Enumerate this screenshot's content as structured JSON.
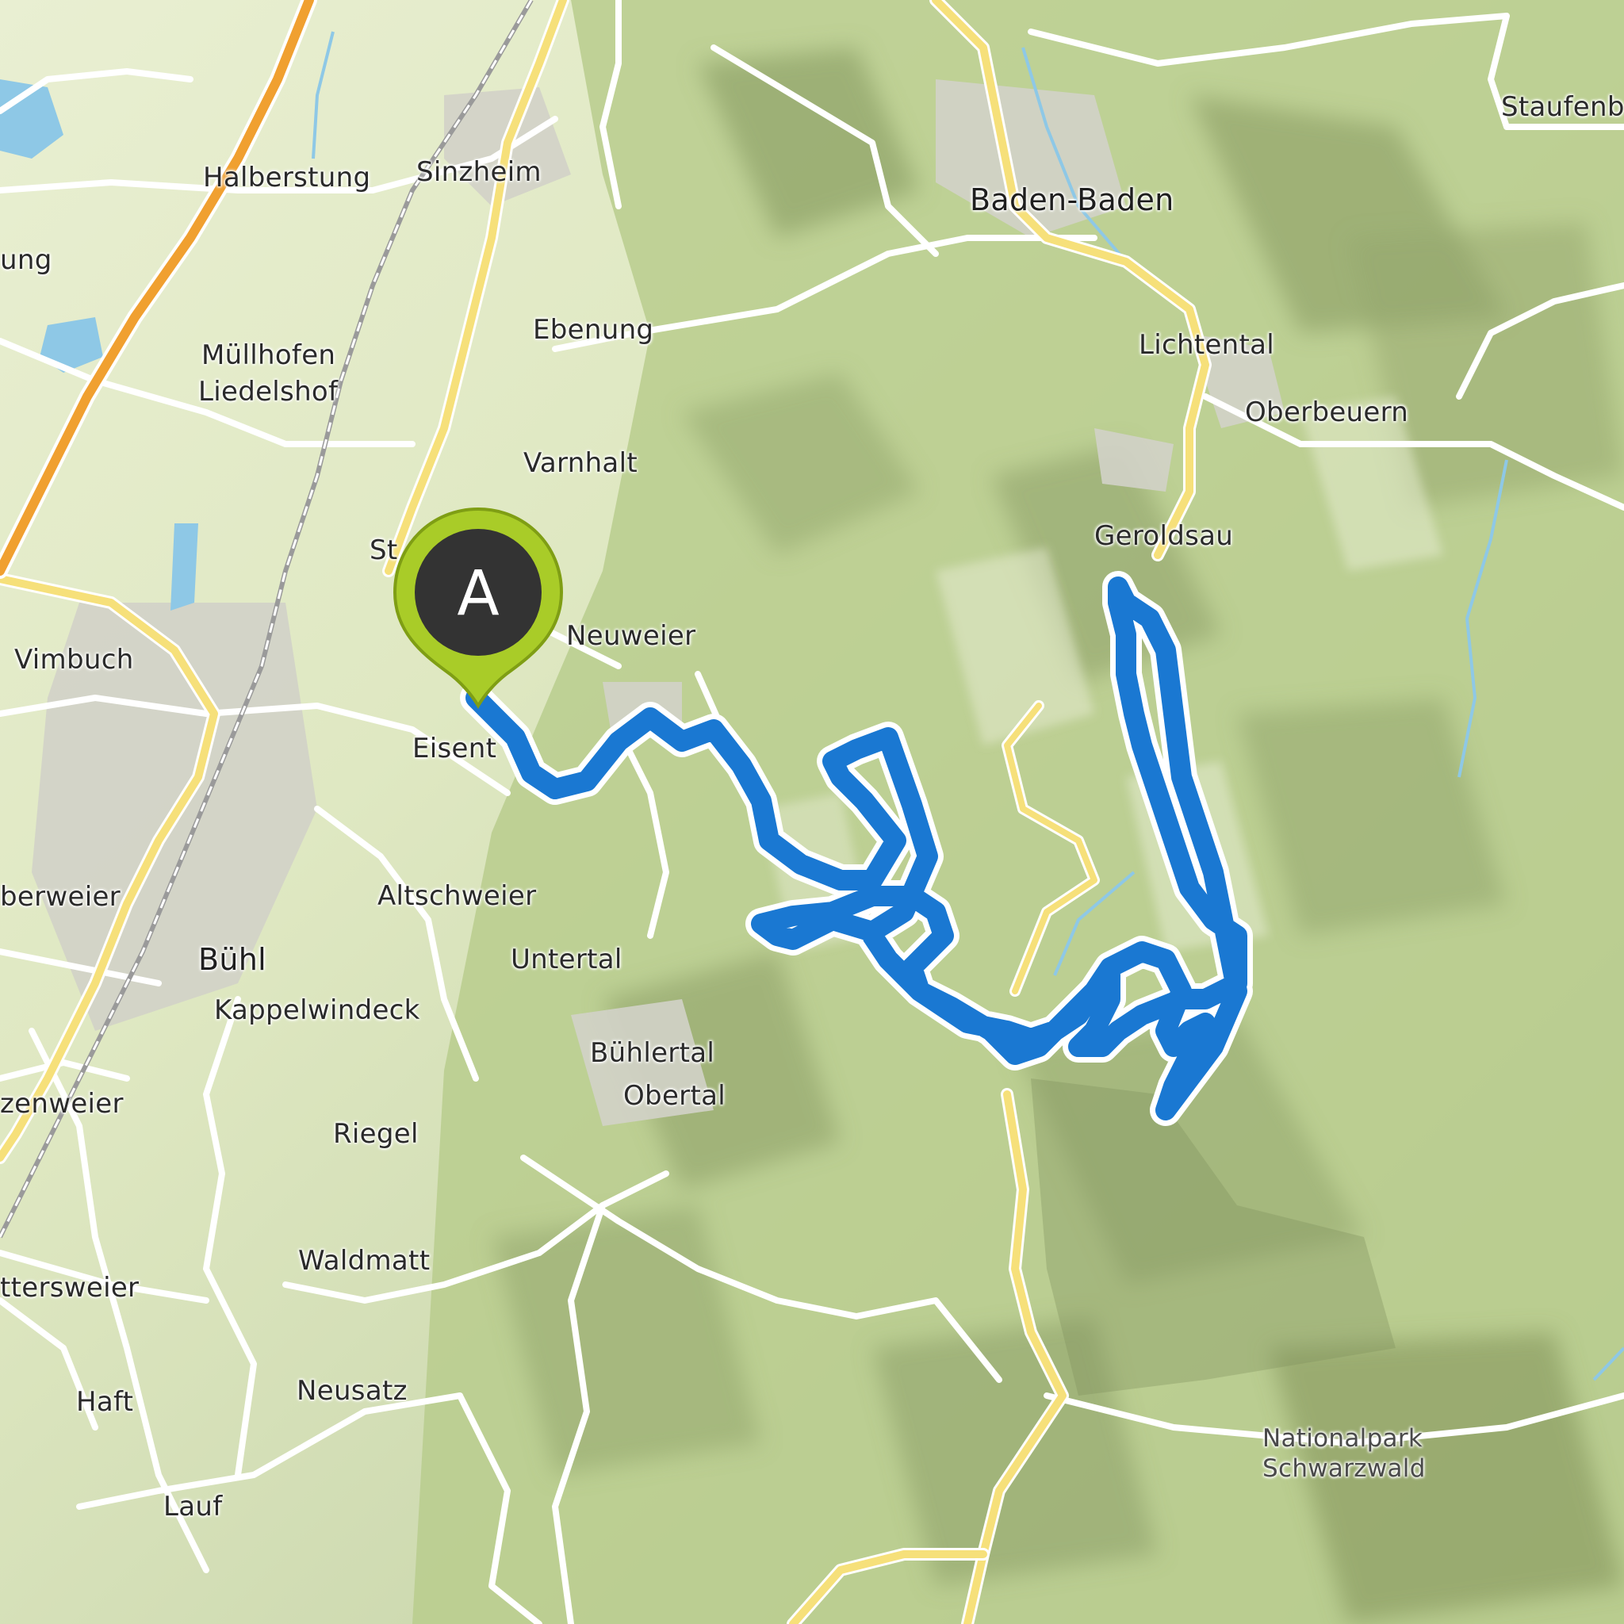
{
  "map": {
    "places": [
      {
        "id": "halberstung",
        "label": "Halberstung"
      },
      {
        "id": "sinzheim",
        "label": "Sinzheim"
      },
      {
        "id": "baden-baden",
        "label": "Baden-Baden"
      },
      {
        "id": "staufenberg",
        "label": "Staufenb"
      },
      {
        "id": "ung",
        "label": "ung"
      },
      {
        "id": "ebenung",
        "label": "Ebenung"
      },
      {
        "id": "muellhofen",
        "label": "Müllhofen"
      },
      {
        "id": "liedelshof",
        "label": "Liedelshof"
      },
      {
        "id": "lichtental",
        "label": "Lichtental"
      },
      {
        "id": "oberbeuern",
        "label": "Oberbeuern"
      },
      {
        "id": "varnhalt",
        "label": "Varnhalt"
      },
      {
        "id": "st",
        "label": "St"
      },
      {
        "id": "geroldsau",
        "label": "Geroldsau"
      },
      {
        "id": "neuweier",
        "label": "Neuweier"
      },
      {
        "id": "vimbuch",
        "label": "Vimbuch"
      },
      {
        "id": "eisental",
        "label": "Eisent"
      },
      {
        "id": "oberweier",
        "label": "berweier"
      },
      {
        "id": "altschweier",
        "label": "Altschweier"
      },
      {
        "id": "buehl",
        "label": "Bühl"
      },
      {
        "id": "untertal",
        "label": "Untertal"
      },
      {
        "id": "kappelwindeck",
        "label": "Kappelwindeck"
      },
      {
        "id": "buehlertal",
        "label": "Bühlertal"
      },
      {
        "id": "obertal",
        "label": "Obertal"
      },
      {
        "id": "zenweier",
        "label": "zenweier"
      },
      {
        "id": "riegel",
        "label": "Riegel"
      },
      {
        "id": "waldmatt",
        "label": "Waldmatt"
      },
      {
        "id": "ottersweier",
        "label": "ttersweier"
      },
      {
        "id": "haft",
        "label": "Haft"
      },
      {
        "id": "neusatz",
        "label": "Neusatz"
      },
      {
        "id": "lauf",
        "label": "Lauf"
      },
      {
        "id": "nationalpark-1",
        "label": "Nationalpark"
      },
      {
        "id": "nationalpark-2",
        "label": "Schwarzwald"
      }
    ],
    "start_marker": {
      "letter": "A"
    },
    "colors": {
      "route": "#1a78d2",
      "marker": "#a9cc28",
      "marker_inner": "#333333",
      "motorway": "#f0a030",
      "main_road": "#f6e07a",
      "water": "#8ec8e6"
    }
  }
}
